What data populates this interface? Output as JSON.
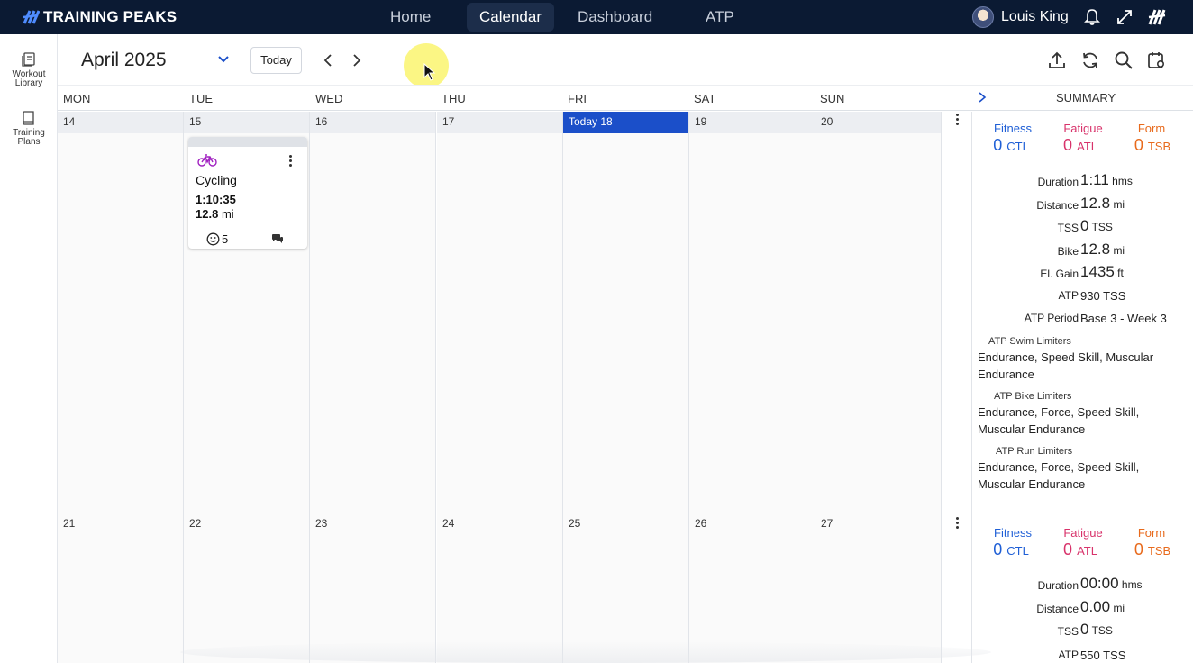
{
  "topbar": {
    "brand": "TRAINING PEAKS",
    "nav": [
      {
        "label": "Home"
      },
      {
        "label": "Calendar"
      },
      {
        "label": "Dashboard"
      },
      {
        "label": "ATP"
      }
    ],
    "active_nav": "Calendar",
    "user_name": "Louis King",
    "icons": [
      "bell-icon",
      "expand-icon",
      "tp-logo-icon"
    ]
  },
  "sidebar": {
    "items": [
      {
        "label_line1": "Workout",
        "label_line2": "Library",
        "icon": "library-icon"
      },
      {
        "label_line1": "Training",
        "label_line2": "Plans",
        "icon": "book-icon"
      }
    ]
  },
  "toolbar": {
    "month": "April 2025",
    "today_label": "Today",
    "icons": [
      "upload-icon",
      "refresh-icon",
      "search-icon",
      "calendar-settings-icon"
    ]
  },
  "calendar": {
    "day_names": [
      "MON",
      "TUE",
      "WED",
      "THU",
      "FRI",
      "SAT",
      "SUN"
    ],
    "summary_label": "SUMMARY",
    "week1": [
      "14",
      "15",
      "16",
      "17",
      "Today 18",
      "19",
      "20"
    ],
    "week2": [
      "21",
      "22",
      "23",
      "24",
      "25",
      "26",
      "27"
    ]
  },
  "workout": {
    "title": "Cycling",
    "duration": "1:10:35",
    "distance_value": "12.8",
    "distance_unit": "mi",
    "feel_count": "5",
    "icon": "bike-icon",
    "color": "#a020c0"
  },
  "summary_week1": {
    "fitness_label": "Fitness",
    "fitness_value": "0",
    "fitness_unit": "CTL",
    "fatigue_label": "Fatigue",
    "fatigue_value": "0",
    "fatigue_unit": "ATL",
    "form_label": "Form",
    "form_value": "0",
    "form_unit": "TSB",
    "rows": [
      {
        "label": "Duration",
        "value": "1:11",
        "unit": "hms"
      },
      {
        "label": "Distance",
        "value": "12.8",
        "unit": "mi"
      },
      {
        "label": "TSS",
        "value": "0",
        "unit": "TSS"
      },
      {
        "label": "Bike",
        "value": "12.8",
        "unit": "mi"
      },
      {
        "label": "El. Gain",
        "value": "1435",
        "unit": "ft"
      },
      {
        "label": "ATP",
        "value": "930",
        "unit": "TSS"
      },
      {
        "label": "ATP Period",
        "value": "Base 3 - Week 3",
        "unit": ""
      }
    ],
    "swim_label": "ATP Swim Limiters",
    "swim_text": "Endurance, Speed Skill, Muscular Endurance",
    "bike_label": "ATP Bike Limiters",
    "bike_text": "Endurance, Force, Speed Skill, Muscular Endurance",
    "run_label": "ATP Run Limiters",
    "run_text": "Endurance, Force, Speed Skill, Muscular Endurance"
  },
  "summary_week2": {
    "fitness_label": "Fitness",
    "fitness_value": "0",
    "fitness_unit": "CTL",
    "fatigue_label": "Fatigue",
    "fatigue_value": "0",
    "fatigue_unit": "ATL",
    "form_label": "Form",
    "form_value": "0",
    "form_unit": "TSB",
    "rows": [
      {
        "label": "Duration",
        "value": "00:00",
        "unit": "hms"
      },
      {
        "label": "Distance",
        "value": "0.00",
        "unit": "mi"
      },
      {
        "label": "TSS",
        "value": "0",
        "unit": "TSS"
      },
      {
        "label": "ATP",
        "value": "550",
        "unit": "TSS"
      }
    ]
  },
  "colors": {
    "topbar": "#0b1a33",
    "today": "#1b4fc9",
    "fitness": "#1f5fd6",
    "fatigue": "#d8336b",
    "form": "#e86a1c"
  }
}
